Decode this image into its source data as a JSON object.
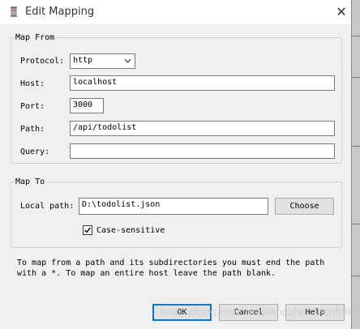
{
  "window": {
    "title": "Edit Mapping",
    "close_glyph": "✕"
  },
  "map_from": {
    "legend": "Map From",
    "protocol_label": "Protocol:",
    "protocol_value": "http",
    "host_label": "Host:",
    "host_value": "localhost",
    "port_label": "Port:",
    "port_value": "3000",
    "path_label": "Path:",
    "path_value": "/api/todolist",
    "query_label": "Query:",
    "query_value": ""
  },
  "map_to": {
    "legend": "Map To",
    "local_path_label": "Local path:",
    "local_path_value": "D:\\todolist.json",
    "choose_label": "Choose",
    "case_sensitive_label": "Case-sensitive",
    "case_sensitive_checked": true
  },
  "help_text": "To map from a path and its subdirectories you must end the path with a *. To map an entire host leave the path blank.",
  "buttons": {
    "ok": "OK",
    "cancel": "Cancel",
    "help": "Help"
  },
  "watermark": "https://blog.csdn.net/liangzhenzhenh0630",
  "colors": {
    "default_button_border": "#0078d7",
    "dialog_bg": "#f0f0f0"
  }
}
